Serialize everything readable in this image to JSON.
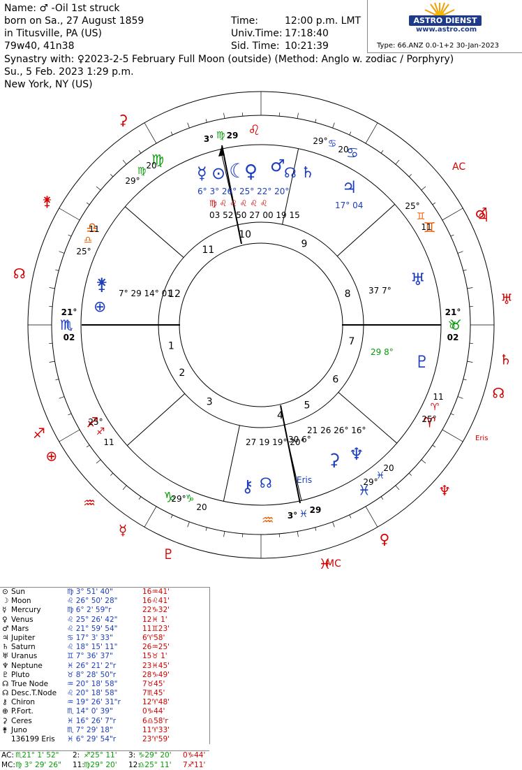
{
  "header": {
    "line1": "Name:  ♂ -Oil 1st struck",
    "line2": "born on Sa., 27 August 1859",
    "line3": "in Titusville, PA (US)",
    "line4": "79w40, 41n38",
    "time_label": "Time:",
    "time_value": "12:00 p.m. LMT",
    "ut_label": "Univ.Time:",
    "ut_value": "17:18:40",
    "sid_label": "Sid. Time:",
    "sid_value": "10:21:39",
    "logo_text": "ASTRO DIENST",
    "logo_url": "www.astro.com",
    "type_line": "Type: 66.ANZ  0.0-1+2  30-Jan-2023"
  },
  "synastry": {
    "line1": "Synastry with: ♀2023-2-5 February Full Moon (outside)  (Method: Anglo w. zodiac / Porphyry)",
    "line2": "Su., 5 Feb. 2023    1:29 p.m.",
    "line3": "New York, NY (US)"
  },
  "chart_data": {
    "type": "table",
    "ascendant_sign": "Scorpio",
    "ascendant_degree": "21° Scorpio 02",
    "mc_degree": "3° Leo 29",
    "inner_houses": [
      "1",
      "2",
      "3",
      "4",
      "5",
      "6",
      "7",
      "8",
      "9",
      "10",
      "11",
      "12"
    ],
    "wheel_labels": {
      "mc_top": [
        "3°",
        "♍",
        "29"
      ],
      "top_right": [
        "29°",
        "♋",
        "20"
      ],
      "top_left": [
        "20",
        "♍",
        "29°"
      ],
      "upper_left": [
        "11",
        "♎",
        "25°"
      ],
      "asc_left": [
        "21°",
        "♏",
        "02"
      ],
      "lower_left": [
        "25°",
        "♐",
        "11"
      ],
      "bottom_left": [
        "29°",
        "♑",
        "20"
      ],
      "ic_bottom": [
        "3°",
        "♓",
        "29"
      ],
      "bottom_right": [
        "20",
        "♓",
        "29°"
      ],
      "lower_right": [
        "11",
        "♈",
        "25°"
      ],
      "desc_right": [
        "21°",
        "♉",
        "02"
      ],
      "upper_right": [
        "25°",
        "♊",
        "11"
      ]
    },
    "inner_planet_labels": [
      {
        "glyphs": "☿⊙☽♀♂",
        "text": "6°  3°  26°  25°  22°  20°"
      },
      {
        "glyphs": "♍",
        "text": "03  52  50  27  00  19  15"
      },
      {
        "glyphs": "♃",
        "text": "17°  04"
      },
      {
        "glyphs": "♅",
        "text": "37  7°"
      },
      {
        "glyphs": "♇",
        "text": "29  8°"
      },
      {
        "glyphs": "♆",
        "text": "21  26  26°  16°"
      },
      {
        "glyphs": "Eris",
        "text": "30  6°"
      },
      {
        "glyphs": "⚷☊",
        "text": "27  19  19°  20°"
      },
      {
        "glyphs": "⚵⊕",
        "text": "7°  29  14°  01"
      }
    ],
    "outer_labels": [
      "AC",
      "MC",
      "Eris"
    ],
    "planets": [
      {
        "glyph": "⊙",
        "name": "Sun",
        "pos": "♍  3° 51' 40\"",
        "transit": "16♒41'"
      },
      {
        "glyph": "☽",
        "name": "Moon",
        "pos": "♌ 26° 50' 28\"",
        "transit": "16♌41'"
      },
      {
        "glyph": "☿",
        "name": "Mercury",
        "pos": "♍  6°  2' 59\"r",
        "transit": "22♑32'"
      },
      {
        "glyph": "♀",
        "name": "Venus",
        "pos": "♌ 25° 26' 42\"",
        "transit": "12♓ 1'"
      },
      {
        "glyph": "♂",
        "name": "Mars",
        "pos": "♌ 21° 59' 54\"",
        "transit": "11♊23'"
      },
      {
        "glyph": "♃",
        "name": "Jupiter",
        "pos": "♋ 17°  3' 33\"",
        "transit": "6♈58'"
      },
      {
        "glyph": "♄",
        "name": "Saturn",
        "pos": "♌ 18° 15' 11\"",
        "transit": "26♒25'"
      },
      {
        "glyph": "♅",
        "name": "Uranus",
        "pos": "♊  7° 36' 37\"",
        "transit": "15♉ 1'"
      },
      {
        "glyph": "♆",
        "name": "Neptune",
        "pos": "♓ 26° 21'  2\"r",
        "transit": "23♓45'"
      },
      {
        "glyph": "♇",
        "name": "Pluto",
        "pos": "♉  8° 28' 50\"r",
        "transit": "28♑49'"
      },
      {
        "glyph": "☊",
        "name": "True Node",
        "pos": "♒ 20° 18' 58\"",
        "transit": "7♉45'"
      },
      {
        "glyph": "☊",
        "name": "Desc.T.Node",
        "pos": "♌ 20° 18' 58\"",
        "transit": "7♏45'"
      },
      {
        "glyph": "⚷",
        "name": "Chiron",
        "pos": "♒ 19° 26' 31\"r",
        "transit": "12♈48'"
      },
      {
        "glyph": "⊕",
        "name": "P.Fort.",
        "pos": "♏ 14°  0' 39\"",
        "transit": "0♑44'"
      },
      {
        "glyph": "⚳",
        "name": "Ceres",
        "pos": "♓ 16° 26'  7\"r",
        "transit": "6♎58'r"
      },
      {
        "glyph": "⚵",
        "name": "Juno",
        "pos": "♏  7° 29' 18\"",
        "transit": "11♈33'"
      },
      {
        "glyph": "",
        "name": "136199 Eris",
        "pos": "♓  6° 29' 54\"r",
        "transit": "23♈59'"
      }
    ],
    "houses": [
      {
        "a": "AC:",
        "av": "♏21°  1' 52\"",
        "b": "2:",
        "bv": "♐25° 11'",
        "c": "3:",
        "cv": "♑29° 20'",
        "d": "0♑44'"
      },
      {
        "a": "MC:",
        "av": "♍ 3° 29' 26\"",
        "b": "11:",
        "bv": "♍29° 20'",
        "c": "12:",
        "cv": "♎25° 11'",
        "d": "7♐11'"
      }
    ]
  }
}
